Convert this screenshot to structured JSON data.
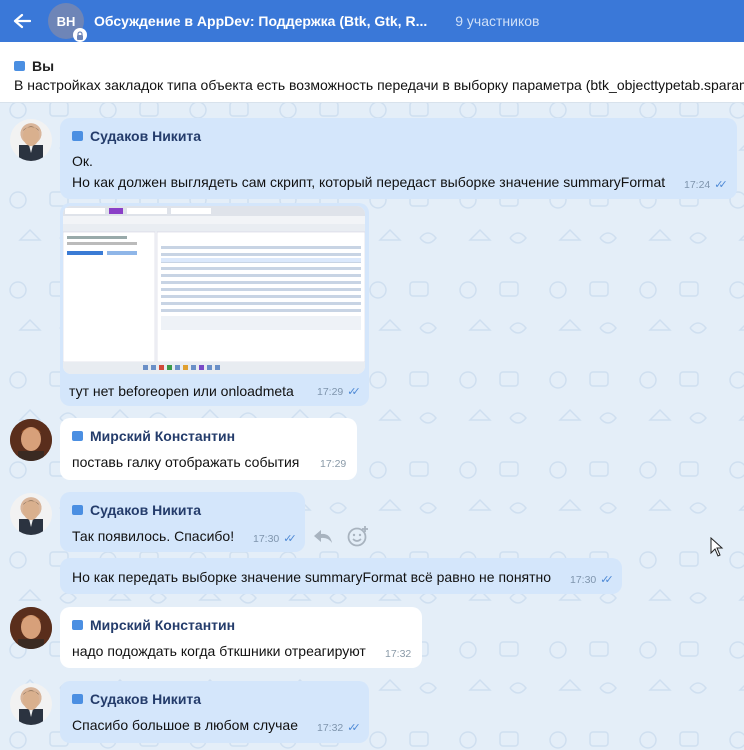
{
  "header": {
    "avatar_initials": "BH",
    "title": "Обсуждение в AppDev: Поддержка (Btk, Gtk, R...",
    "members": "9 участников"
  },
  "pinned": {
    "author": "Вы",
    "text": "В настройках закладок типа объекта есть возможность передачи в выборку параметра (btk_objecttypetab.sparam)"
  },
  "messages": [
    {
      "sender": "Судаков Никита",
      "lines": [
        "Ок.",
        "Но как должен выглядеть сам скрипт, который передаст выборке значение summaryFormat"
      ],
      "time": "17:24"
    },
    {
      "caption": "тут нет beforeopen или onloadmeta",
      "time": "17:29"
    },
    {
      "sender": "Мирский Константин",
      "text": "поставь галку отображать события",
      "time": "17:29"
    },
    {
      "sender": "Судаков Никита",
      "text": "Так появилось. Спасибо!",
      "time": "17:30"
    },
    {
      "text": "Но как передать выборке значение summaryFormat всё равно не понятно",
      "time": "17:30"
    },
    {
      "sender": "Мирский Константин",
      "text": "надо подождать когда бткшники отреагируют",
      "time": "17:32"
    },
    {
      "sender": "Судаков Никита",
      "text": "Спасибо большое в любом случае",
      "time": "17:32"
    }
  ],
  "colors": {
    "header": "#3a78d8",
    "outgoing_bubble": "#d4e6fb",
    "incoming_bubble": "#ffffff",
    "accent": "#4b8fe2"
  },
  "icons": [
    "back-arrow-icon",
    "lock-icon",
    "cube-icon",
    "double-check-icon",
    "reply-icon",
    "add-reaction-icon",
    "mouse-cursor-icon"
  ]
}
